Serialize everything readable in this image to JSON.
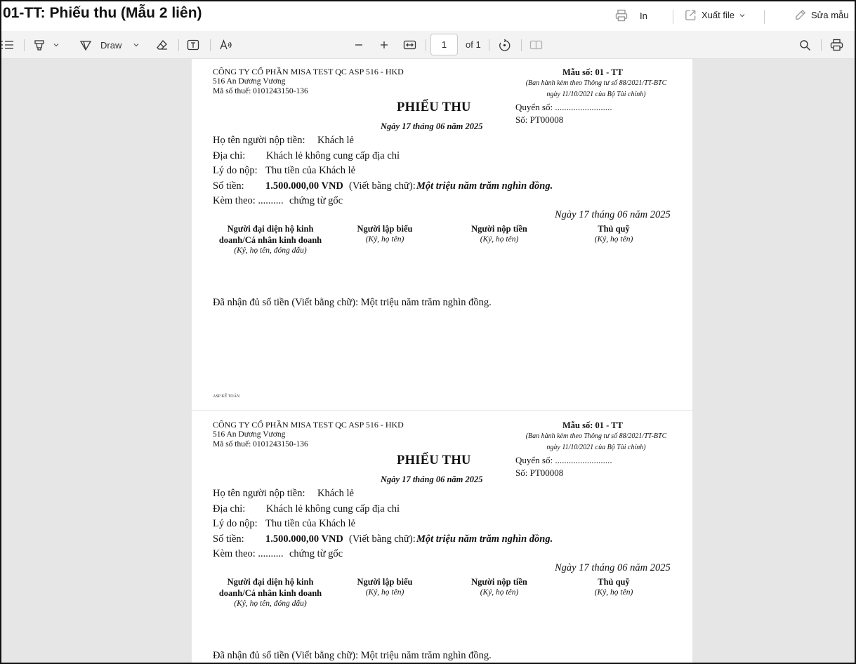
{
  "header": {
    "title": "01-TT: Phiếu thu (Mẫu 2 liên)",
    "print_label": "In",
    "export_label": "Xuất file",
    "edit_label": "Sửa mẫu"
  },
  "toolbar": {
    "draw_label": "Draw",
    "page_number": "1",
    "page_of": "of 1"
  },
  "voucher": {
    "company_name": "CÔNG TY CỔ PHẦN MISA TEST QC ASP 516 - HKD",
    "company_address": "516 An Dương Vương",
    "company_tax": "Mã số thuế: 0101243150-136",
    "form_no": "Mẫu số: 01 - TT",
    "issued_line1": "(Ban hành kèm theo Thông tư số 88/2021/TT-BTC",
    "issued_line2": "ngày 11/10/2021 của Bộ Tài chính)",
    "title": "PHIẾU THU",
    "date_bold": "Ngày 17 tháng 06 năm 2025",
    "book_no": "Quyển số: .........................",
    "voucher_no": "Số: PT00008",
    "payer_label": "Họ tên người nộp tiền:",
    "payer_value": "Khách lẻ",
    "address_label": "Địa chỉ:",
    "address_value": "Khách lẻ không cung cấp địa chỉ",
    "reason_label": "Lý do nộp:",
    "reason_value": "Thu tiền của Khách lẻ",
    "amount_label": "Số tiền:",
    "amount_value": "1.500.000,00 VND",
    "amount_words_label": "(Viết bằng chữ):",
    "amount_words_value": "Một triệu năm trăm nghìn đồng.",
    "attach_label": "Kèm theo: ..........",
    "attach_value": "chứng từ gốc",
    "date_right": "Ngày 17 tháng 06 năm 2025",
    "sig1_title": "Người đại diện hộ kinh doanh/Cá nhân kinh doanh",
    "sig1_note": "(Ký, họ tên, đóng dấu)",
    "sig2_title": "Người lập biểu",
    "sig2_note": "(Ký, họ tên)",
    "sig3_title": "Người nộp tiền",
    "sig3_note": "(Ký, họ tên)",
    "sig4_title": "Thủ quỹ",
    "sig4_note": "(Ký, họ tên)",
    "received": "Đã nhận đủ số tiền (Viết bằng chữ): Một triệu năm trăm nghìn đồng.",
    "footer": "ASP KẾ TOÁN"
  },
  "icons": {
    "print": "printer-icon",
    "export": "export-icon",
    "edit": "pencil-icon",
    "list": "list-icon",
    "highlight": "highlighter-icon",
    "draw": "draw-icon",
    "erase": "eraser-icon",
    "textbox": "textbox-icon",
    "read_aloud": "read-aloud-icon",
    "zoom_out": "minus-icon",
    "zoom_in": "plus-icon",
    "fit": "fit-width-icon",
    "rotate": "rotate-icon",
    "two_page": "two-page-icon",
    "search": "search-icon",
    "print_toolbar": "printer-icon"
  }
}
